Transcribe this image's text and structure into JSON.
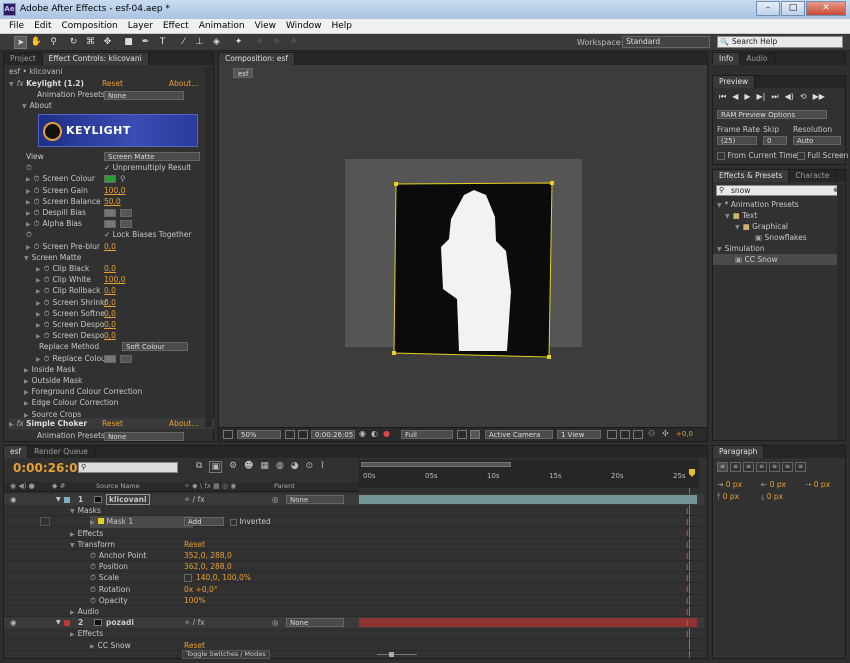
{
  "app": {
    "title": "Adobe After Effects - esf-04.aep *",
    "icon": "Ae"
  },
  "menu": [
    "File",
    "Edit",
    "Composition",
    "Layer",
    "Effect",
    "Animation",
    "View",
    "Window",
    "Help"
  ],
  "workspace": {
    "label": "Workspace:",
    "value": "Standard"
  },
  "search_help": {
    "placeholder": "Search Help"
  },
  "project_panel": {
    "tabs": [
      "Project",
      "Effect Controls: klicovani"
    ],
    "layer_path": "esf • klicovani",
    "effect1": {
      "name": "Keylight (1.2)",
      "reset": "Reset",
      "about": "About...",
      "presets_label": "Animation Presets:",
      "presets_value": "None",
      "about_group": "About",
      "logo_text": "KEYLIGHT"
    },
    "props": [
      {
        "label": "View",
        "value": "Screen Matte",
        "kind": "select"
      },
      {
        "label": "",
        "value": "Unpremultiply Result",
        "kind": "check"
      },
      {
        "label": "Screen Colour",
        "value": "",
        "kind": "color"
      },
      {
        "label": "Screen Gain",
        "value": "100,0",
        "kind": "num"
      },
      {
        "label": "Screen Balance",
        "value": "50,0",
        "kind": "num"
      },
      {
        "label": "Despill Bias",
        "value": "",
        "kind": "swatch"
      },
      {
        "label": "Alpha Bias",
        "value": "",
        "kind": "swatch"
      },
      {
        "label": "",
        "value": "Lock Biases Together",
        "kind": "check"
      },
      {
        "label": "Screen Pre-blur",
        "value": "0,0",
        "kind": "num"
      },
      {
        "label": "Screen Matte",
        "value": "",
        "kind": "group"
      },
      {
        "label": "Clip Black",
        "value": "0,0",
        "kind": "num"
      },
      {
        "label": "Clip White",
        "value": "100,0",
        "kind": "num"
      },
      {
        "label": "Clip Rollback",
        "value": "0,0",
        "kind": "num"
      },
      {
        "label": "Screen Shrink/",
        "value": "0,0",
        "kind": "num"
      },
      {
        "label": "Screen Softne",
        "value": "0,0",
        "kind": "num"
      },
      {
        "label": "Screen Despo",
        "value": "0,0",
        "kind": "num"
      },
      {
        "label": "Screen Despo",
        "value": "0,0",
        "kind": "num"
      },
      {
        "label": "Replace Method",
        "value": "Soft Colour",
        "kind": "select"
      },
      {
        "label": "Replace Colou",
        "value": "",
        "kind": "swatch"
      },
      {
        "label": "Inside Mask",
        "value": "",
        "kind": "group"
      },
      {
        "label": "Outside Mask",
        "value": "",
        "kind": "group"
      },
      {
        "label": "Foreground Colour Correction",
        "value": "",
        "kind": "group"
      },
      {
        "label": "Edge Colour Correction",
        "value": "",
        "kind": "group"
      },
      {
        "label": "Source Crops",
        "value": "",
        "kind": "group"
      }
    ],
    "effect2": {
      "name": "Simple Choker",
      "reset": "Reset",
      "about": "About...",
      "presets_label": "Animation Presets:",
      "presets_value": "None"
    }
  },
  "comp_panel": {
    "tab": "Composition: esf",
    "comp_tab": "esf",
    "footer": {
      "zoom": "50%",
      "timecode": "0:00:26:05",
      "resolution": "Full",
      "camera": "Active Camera",
      "views": "1 View",
      "exposure": "+0,0"
    }
  },
  "right_panels": {
    "info_tabs": [
      "Info",
      "Audio"
    ],
    "preview": {
      "tab": "Preview",
      "ram": "RAM Preview Options",
      "frame_rate_label": "Frame Rate",
      "frame_rate": "(25)",
      "skip_label": "Skip",
      "skip": "0",
      "resolution_label": "Resolution",
      "resolution": "Auto",
      "from_current": "From Current Time",
      "full_screen": "Full Screen"
    },
    "effects": {
      "tabs": [
        "Effects & Presets",
        "Characte"
      ],
      "search": "snow",
      "tree": [
        "* Animation Presets",
        "Text",
        "Graphical",
        "Snowflakes",
        "Simulation",
        "CC Snow"
      ]
    },
    "paragraph": {
      "tab": "Paragraph",
      "fields": [
        "0 px",
        "0 px",
        "0 px",
        "0 px",
        "0 px"
      ]
    }
  },
  "timeline": {
    "tabs": [
      "esf",
      "Render Queue"
    ],
    "timecode": "0:00:26:05",
    "col_source": "Source Name",
    "col_parent": "Parent",
    "ruler": [
      "00s",
      "05s",
      "10s",
      "15s",
      "20s",
      "25s"
    ],
    "layers": [
      {
        "num": "1",
        "name": "klicovani",
        "parent": "None",
        "color": "#7fb0c8"
      },
      {
        "num": "2",
        "name": "pozadi",
        "parent": "None",
        "color": "#c03838"
      }
    ],
    "sub": [
      {
        "indent": 1,
        "label": "Masks",
        "value": ""
      },
      {
        "indent": 2,
        "label": "Mask 1",
        "value": "Add",
        "extra": "Inverted"
      },
      {
        "indent": 1,
        "label": "Effects",
        "value": ""
      },
      {
        "indent": 1,
        "label": "Transform",
        "value": "Reset"
      },
      {
        "indent": 2,
        "label": "Anchor Point",
        "value": "352,0, 288,0"
      },
      {
        "indent": 2,
        "label": "Position",
        "value": "362,0, 288,0"
      },
      {
        "indent": 2,
        "label": "Scale",
        "value": "140,0, 100,0%"
      },
      {
        "indent": 2,
        "label": "Rotation",
        "value": "0x +0,0°"
      },
      {
        "indent": 2,
        "label": "Opacity",
        "value": "100%"
      },
      {
        "indent": 1,
        "label": "Audio",
        "value": ""
      }
    ],
    "sub2": [
      {
        "indent": 1,
        "label": "Effects",
        "value": ""
      },
      {
        "indent": 2,
        "label": "CC Snow",
        "value": "Reset"
      }
    ],
    "toggle": "Toggle Switches / Modes"
  },
  "colors": {
    "accent": "#e8a033",
    "selection": "#e6d21c",
    "layer1": "#7fb0c8",
    "layer2": "#a33030"
  }
}
